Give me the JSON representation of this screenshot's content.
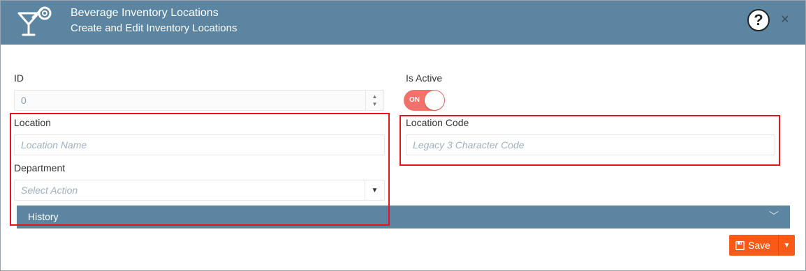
{
  "header": {
    "title": "Beverage Inventory Locations",
    "subtitle": "Create and Edit Inventory Locations",
    "logo_icon": "cocktail-glass-icon",
    "help_label": "?",
    "close_label": "×",
    "background_color": "#5b85a0"
  },
  "form": {
    "id": {
      "label": "ID",
      "value": "0"
    },
    "is_active": {
      "label": "Is Active",
      "toggle_text": "ON",
      "checked": true,
      "color": "#f4706a"
    },
    "location": {
      "label": "Location",
      "placeholder": "Location Name"
    },
    "location_code": {
      "label": "Location Code",
      "placeholder": "Legacy 3 Character Code"
    },
    "department": {
      "label": "Department",
      "placeholder": "Select Action"
    }
  },
  "history": {
    "label": "History"
  },
  "footer": {
    "save_label": "Save",
    "save_color": "#fb5a16"
  },
  "annotations": {
    "highlight_color": "#e8141b"
  }
}
